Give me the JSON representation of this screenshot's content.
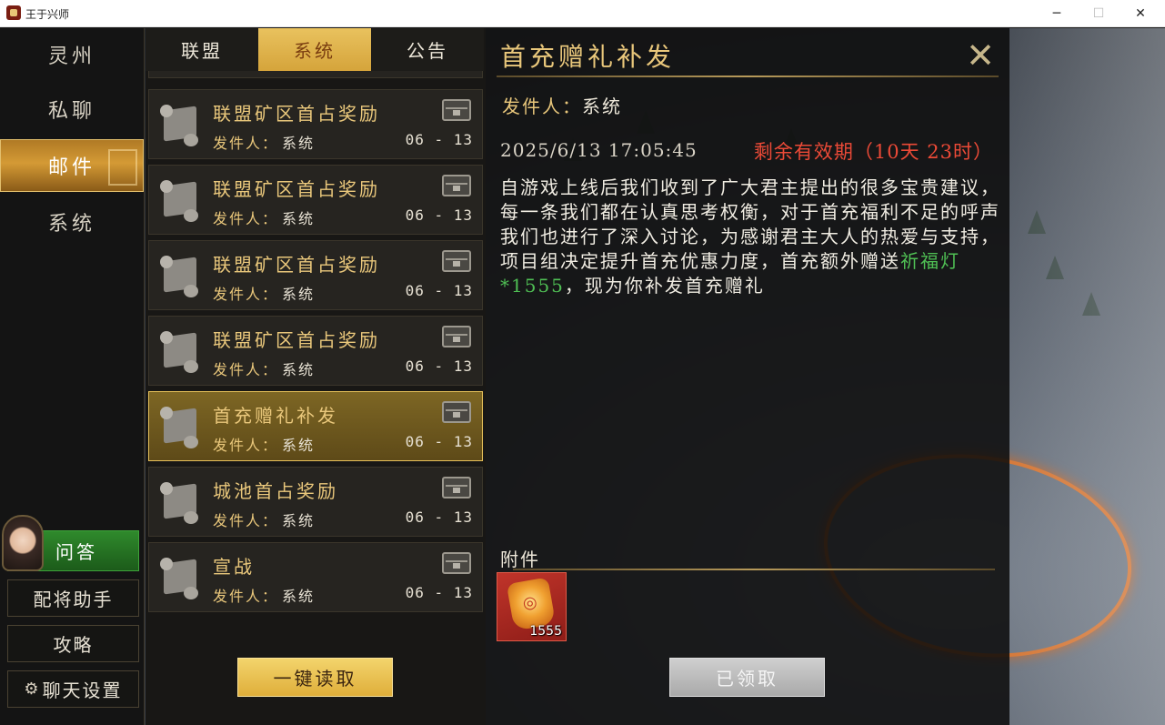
{
  "window": {
    "title": "王于兴师",
    "minimize": "─",
    "maximize": "☐",
    "close": "✕"
  },
  "left_nav": {
    "items": [
      {
        "label": "灵州",
        "active": false
      },
      {
        "label": "私聊",
        "active": false
      },
      {
        "label": "邮件",
        "active": true
      },
      {
        "label": "系统",
        "active": false
      }
    ],
    "qa_label": "问答",
    "assistant_label": "配将助手",
    "guide_label": "攻略",
    "chat_settings_label": "聊天设置",
    "gear_glyph": "⚙"
  },
  "tabs": [
    {
      "label": "联盟",
      "active": false
    },
    {
      "label": "系统",
      "active": true
    },
    {
      "label": "公告",
      "active": false
    }
  ],
  "mail_list": [
    {
      "title": "联盟矿区首占奖励",
      "sender_label": "发件人：",
      "sender": "系统",
      "date": "06 - 13",
      "selected": false
    },
    {
      "title": "联盟矿区首占奖励",
      "sender_label": "发件人：",
      "sender": "系统",
      "date": "06 - 13",
      "selected": false
    },
    {
      "title": "联盟矿区首占奖励",
      "sender_label": "发件人：",
      "sender": "系统",
      "date": "06 - 13",
      "selected": false
    },
    {
      "title": "联盟矿区首占奖励",
      "sender_label": "发件人：",
      "sender": "系统",
      "date": "06 - 13",
      "selected": false
    },
    {
      "title": "首充赠礼补发",
      "sender_label": "发件人：",
      "sender": "系统",
      "date": "06 - 13",
      "selected": true
    },
    {
      "title": "城池首占奖励",
      "sender_label": "发件人：",
      "sender": "系统",
      "date": "06 - 13",
      "selected": false
    },
    {
      "title": "宣战",
      "sender_label": "发件人：",
      "sender": "系统",
      "date": "06 - 13",
      "selected": false
    }
  ],
  "read_all_label": "一键读取",
  "detail": {
    "title": "首充赠礼补发",
    "close_glyph": "✕",
    "sender_label": "发件人：",
    "sender": "系统",
    "datetime": "2025/6/13 17:05:45",
    "expiry": "剩余有效期（10天 23时）",
    "body_before": "自游戏上线后我们收到了广大君主提出的很多宝贵建议，每一条我们都在认真思考权衡，对于首充福利不足的呼声我们也进行了深入讨论，为感谢君主大人的热爱与支持，项目组决定提升首充优惠力度，首充额外赠送",
    "body_highlight": "祈福灯*1555",
    "body_after": "，现为你补发首充赠礼",
    "attachment_label": "附件",
    "attachment_count": "1555",
    "claimed_label": "已领取"
  },
  "colors": {
    "gold_text": "#e9c77b",
    "active_tab": "#d5a43b",
    "expiry_red": "#ec4a37",
    "highlight_green": "#4fbf54",
    "qa_green": "#2f8a2c"
  }
}
